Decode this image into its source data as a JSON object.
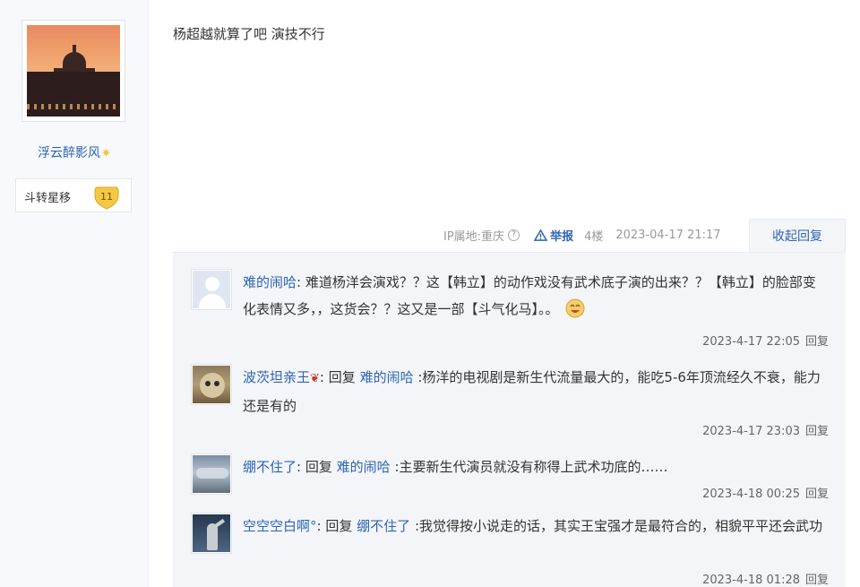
{
  "author": {
    "name": "浮云醉影风",
    "badge_icon": "sparkle-star-icon",
    "level_title": "斗转星移",
    "level_number": "11"
  },
  "post": {
    "content": "杨超越就算了吧 演技不行"
  },
  "meta": {
    "ip_location": "IP属地:重庆",
    "help_icon": "?",
    "report_label": "举报",
    "floor": "4楼",
    "datetime": "2023-04-17 21:17",
    "collapse_label": "收起回复"
  },
  "replies": [
    {
      "nick": "难的闹哈",
      "prefix": ":",
      "reply_word": "",
      "target": "",
      "text": " 难道杨洋会演戏？？这【韩立】的动作戏没有武术底子演的出来？？【韩立】的脸部变化表情又多，，这货会？？这又是一部【斗气化马】。。",
      "time": "2023-4-17 22:05",
      "reply_label": "回复",
      "avatar_icon": "default-user-avatar",
      "emoji": "laugh-emoji-icon"
    },
    {
      "nick": "波茨坦亲王",
      "prefix": ":",
      "reply_word": "回复",
      "target": "难的闹哈",
      "text": ":杨洋的电视剧是新生代流量最大的，能吃5-6年顶流经久不衰，能力还是有的",
      "time": "2023-4-17 23:03",
      "reply_label": "回复",
      "avatar_icon": "cat-avatar",
      "name_decoration": "rose-icon"
    },
    {
      "nick": "绷不住了",
      "prefix": ":",
      "reply_word": "回复",
      "target": "难的闹哈",
      "text": ":主要新生代演员就没有称得上武术功底的……",
      "time": "2023-4-18 00:25",
      "reply_label": "回复",
      "avatar_icon": "sky-avatar"
    },
    {
      "nick": "空空空白啊°",
      "prefix": ":",
      "reply_word": "回复",
      "target": "绷不住了",
      "text": ":我觉得按小说走的话，其实王宝强才是最符合的，相貌平平还会武功",
      "time": "2023-4-18 01:28",
      "reply_label": "回复",
      "avatar_icon": "statue-avatar"
    }
  ],
  "colors": {
    "link": "#2d64b3",
    "reply_bg": "#f3f5f8",
    "badge_gold": "#f3c845"
  }
}
